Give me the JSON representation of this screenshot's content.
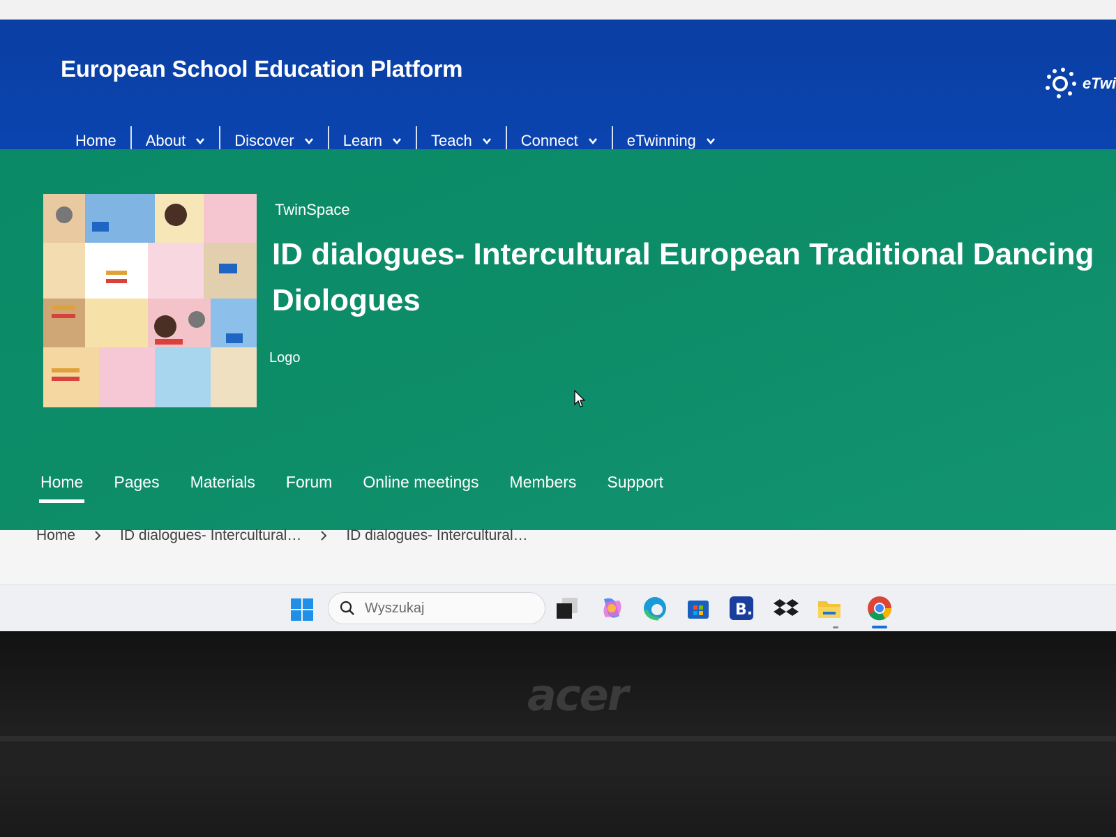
{
  "header": {
    "site_title": "European School Education Platform",
    "brand_logo_text": "eTwin",
    "nav": [
      {
        "label": "Home"
      },
      {
        "label": "About"
      },
      {
        "label": "Discover"
      },
      {
        "label": "Learn"
      },
      {
        "label": "Teach"
      },
      {
        "label": "Connect"
      },
      {
        "label": "eTwinning"
      }
    ]
  },
  "hero": {
    "section_label": "TwinSpace",
    "title": "ID dialogues- Intercultural European Traditional Dancing",
    "title_line2": "Diologues",
    "logo_caption": "Logo"
  },
  "tabs": [
    {
      "label": "Home",
      "active": true
    },
    {
      "label": "Pages",
      "active": false
    },
    {
      "label": "Materials",
      "active": false
    },
    {
      "label": "Forum",
      "active": false
    },
    {
      "label": "Online meetings",
      "active": false
    },
    {
      "label": "Members",
      "active": false
    },
    {
      "label": "Support",
      "active": false
    }
  ],
  "breadcrumb": [
    "Home",
    "ID dialogues- Intercultural…",
    "ID dialogues- Intercultural…"
  ],
  "taskbar": {
    "search_placeholder": "Wyszukaj",
    "apps": [
      "task-view-icon",
      "copilot-icon",
      "edge-icon",
      "store-icon",
      "booking-icon",
      "dropbox-icon",
      "file-explorer-icon",
      "chrome-icon"
    ]
  },
  "device": {
    "brand": "acer"
  },
  "colors": {
    "header_blue": "#0b44b0",
    "hero_green": "#0e8d69",
    "taskbar": "#eef0f3"
  }
}
